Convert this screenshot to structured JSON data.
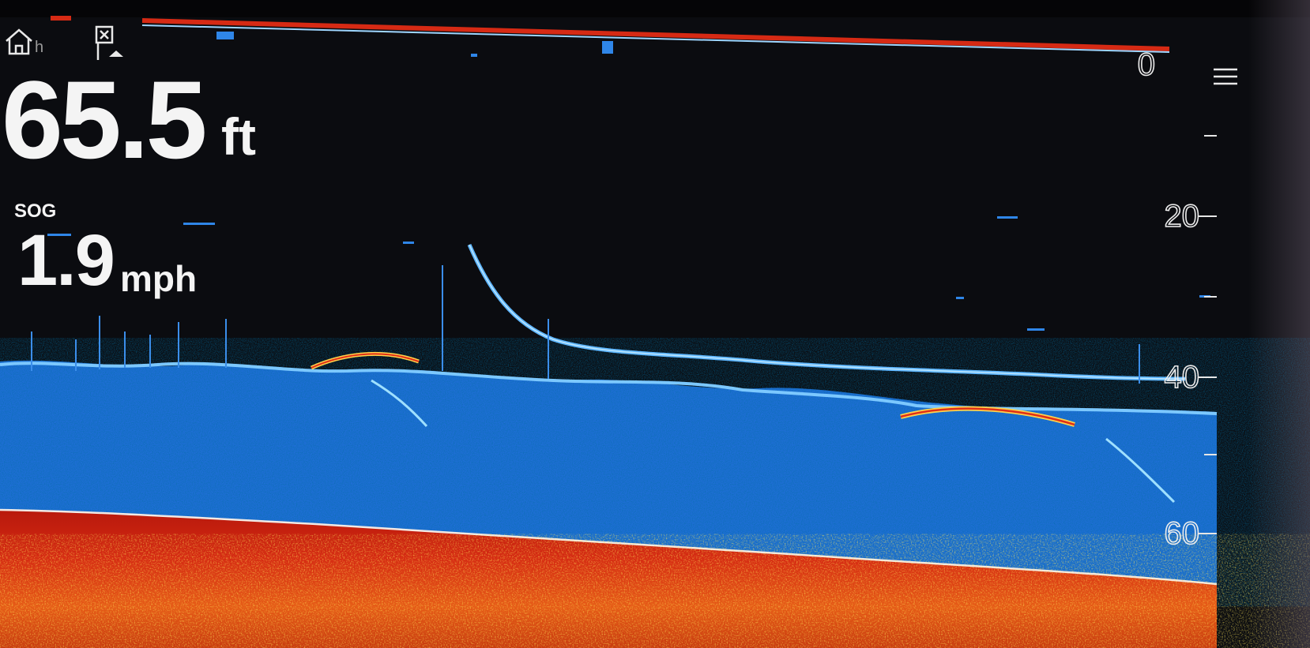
{
  "depth": {
    "value": "65.5",
    "unit": "ft"
  },
  "speed": {
    "label": "SOG",
    "value": "1.9",
    "unit": "mph"
  },
  "depth_scale": {
    "labels": [
      "0",
      "20",
      "40",
      "60"
    ],
    "range_ft": [
      0,
      70
    ]
  },
  "icons": {
    "home": "home-icon",
    "waypoint": "waypoint-icon",
    "menu": "menu-icon"
  },
  "colors": {
    "background": "#0b0c10",
    "water_column": "#1f6fd6",
    "bottom_return": "#c2200e",
    "bottom_hot": "#ffcc22",
    "text": "#f4f4f4"
  }
}
